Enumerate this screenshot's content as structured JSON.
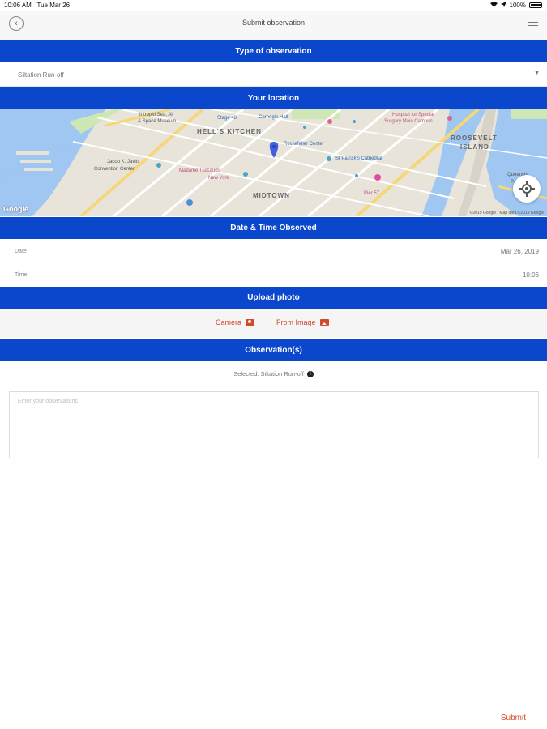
{
  "status_bar": {
    "time": "10:06 AM",
    "date": "Tue Mar 26",
    "battery": "100%"
  },
  "nav": {
    "title": "Submit observation"
  },
  "sections": {
    "type": "Type of observation",
    "location": "Your location",
    "datetime": "Date & Time Observed",
    "upload": "Upload photo",
    "observations": "Observation(s)"
  },
  "type_select": {
    "value": "Siltation Run-off"
  },
  "map": {
    "labels": {
      "hells_kitchen": "HELL'S KITCHEN",
      "midtown": "MIDTOWN",
      "roosevelt": "ROOSEVELT",
      "island": "ISLAND",
      "intrepid_1": "Intrepid Sea, Air",
      "intrepid_2": "& Space Museum",
      "stage48": "Stage 48",
      "carnegie": "Carnegie Hall",
      "rockefeller": "Rockefeller Center",
      "st_patricks": "St Patrick's Cathedral",
      "hospital_1": "Hospital for Special",
      "hospital_2": "Surgery Main Campus",
      "javits_1": "Jacob K. Javits",
      "javits_2": "Convention Center",
      "tussauds_1": "Madame Tussauds",
      "tussauds_2": "New York",
      "pier57": "Pier 57",
      "queensbridge_1": "Queensbr",
      "queensbridge_2": "Pa",
      "google": "Google",
      "copyright": "©2019 Google · Map data ©2019 Google"
    }
  },
  "datetime": {
    "date_label": "Date",
    "date_value": "Mar 26, 2019",
    "time_label": "Time",
    "time_value": "10:06"
  },
  "upload": {
    "camera": "Camera",
    "from_image": "From Image"
  },
  "observations": {
    "selected": "Selected: Siltation Run-off",
    "placeholder": "Enter your observations"
  },
  "submit": "Submit",
  "colors": {
    "header_blue": "#0a47cc",
    "accent_red": "#d24a2c"
  }
}
